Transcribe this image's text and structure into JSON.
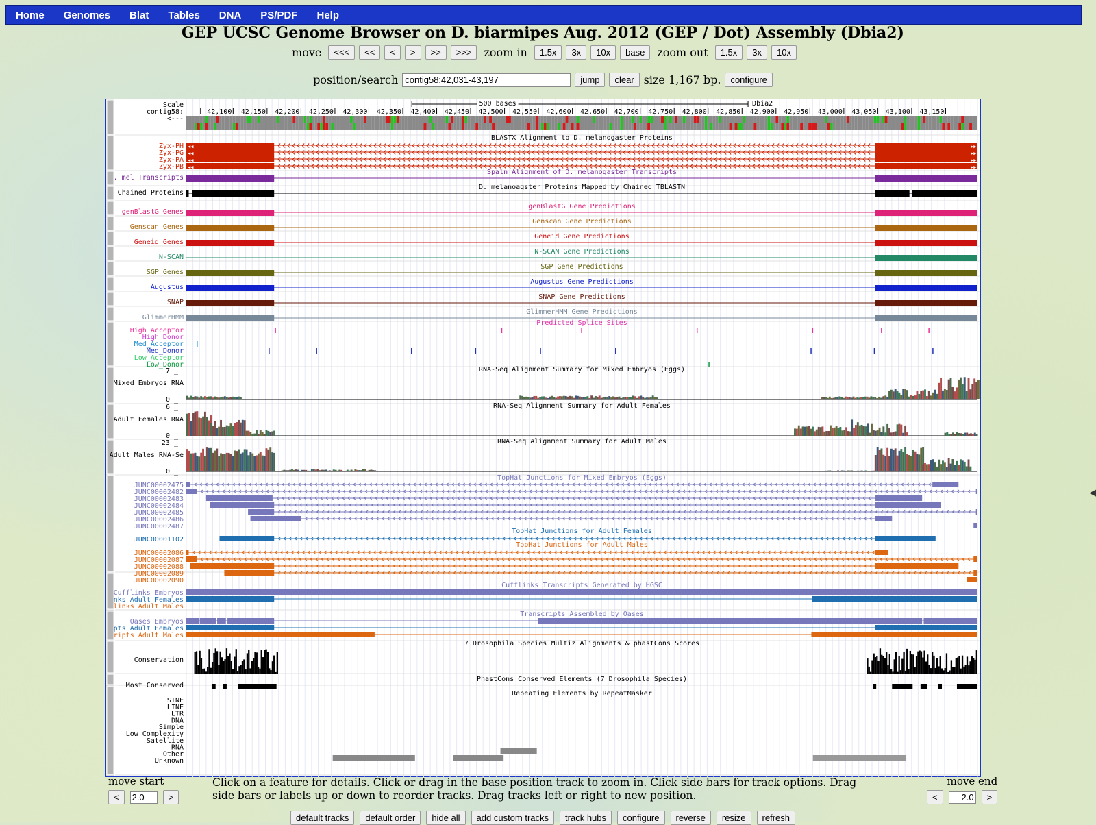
{
  "menu": [
    "Home",
    "Genomes",
    "Blat",
    "Tables",
    "DNA",
    "PS/PDF",
    "Help"
  ],
  "page_title": "GEP UCSC Genome Browser on D. biarmipes Aug. 2012 (GEP / Dot) Assembly (Dbia2)",
  "nav": {
    "move_label": "move",
    "move_buttons": [
      "<<<",
      "<<",
      "<",
      ">",
      ">>",
      ">>>"
    ],
    "zoom_in_label": "zoom in",
    "zoom_in_buttons": [
      "1.5x",
      "3x",
      "10x",
      "base"
    ],
    "zoom_out_label": "zoom out",
    "zoom_out_buttons": [
      "1.5x",
      "3x",
      "10x"
    ]
  },
  "position": {
    "label": "position/search",
    "value": "contig58:42,031-43,197",
    "jump": "jump",
    "clear": "clear",
    "size_text": "size 1,167 bp.",
    "configure": "configure"
  },
  "ruler": {
    "scale_label": "Scale",
    "chrom_label": "contig58:",
    "strand_label": "<---",
    "scale_text": "500 bases",
    "assembly": "Dbia2",
    "start": 42031,
    "end": 43197,
    "ticks": [
      "42,100",
      "42,150",
      "42,200",
      "42,250",
      "42,300",
      "42,350",
      "42,400",
      "42,450",
      "42,500",
      "42,550",
      "42,600",
      "42,650",
      "42,700",
      "42,750",
      "42,800",
      "42,850",
      "42,900",
      "42,950",
      "43,000",
      "43,050",
      "43,100",
      "43,150"
    ]
  },
  "colors": {
    "menubar": "#1a37c7",
    "blastx": "#cc2200",
    "spaln": "#7a2a9a",
    "chained": "#000000",
    "genblast": "#dd2277",
    "genscan": "#aa6611",
    "geneid": "#cc1111",
    "nscan": "#228866",
    "sgp": "#666611",
    "augustus": "#1122cc",
    "snap": "#661a0a",
    "glimmer": "#778899",
    "tophat_embryo": "#7777bb",
    "tophat_female": "#1f6fb0",
    "tophat_male": "#dd6611",
    "conservation": "#000000"
  },
  "tracks": {
    "blastx_title": "BLASTX Alignment to D. melanogaster Proteins",
    "blastx_items": [
      "Zyx-PH",
      "Zyx-PG",
      "Zyx-PA",
      "Zyx-PB"
    ],
    "spaln_label": ". mel Transcripts",
    "spaln_title": "Spaln Alignment of D. melanogaster Transcripts",
    "chained_label": "Chained Proteins",
    "chained_title": "D. melanoagster Proteins Mapped by Chained TBLASTN",
    "genblast_label": "genBlastG Genes",
    "genblast_title": "genBlastG Gene Predictions",
    "genscan_label": "Genscan Genes",
    "genscan_title": "Genscan Gene Predictions",
    "geneid_label": "Geneid Genes",
    "geneid_title": "Geneid Gene Predictions",
    "nscan_label": "N-SCAN",
    "nscan_title": "N-SCAN Gene Predictions",
    "sgp_label": "SGP Genes",
    "sgp_title": "SGP Gene Predictions",
    "augustus_label": "Augustus",
    "augustus_title": "Augustus Gene Predictions",
    "snap_label": "SNAP",
    "snap_title": "SNAP Gene Predictions",
    "glimmer_label": "GlimmerHMM",
    "glimmer_title": "GlimmerHMM Gene Predictions",
    "splice_title": "Predicted Splice Sites",
    "splice_labels": [
      "High_Acceptor",
      "High_Donor",
      "Med_Acceptor",
      "Med_Donor",
      "Low_Acceptor",
      "Low_Donor"
    ],
    "rna_embryo_title": "RNA-Seq Alignment Summary for Mixed Embryos (Eggs)",
    "rna_embryo_label": "Mixed Embryos RNA",
    "rna_embryo_max": "7 _",
    "rna_embryo_min": "0 _",
    "rna_female_title": "RNA-Seq Alignment Summary for Adult Females",
    "rna_female_label": "Adult Females RNA",
    "rna_female_max": "6 _",
    "rna_female_min": "0 _",
    "rna_male_title": "RNA-Seq Alignment Summary for Adult Males",
    "rna_male_label": "Adult Males RNA-Se",
    "rna_male_max": "23 _",
    "rna_male_min": "0 _",
    "tophat_embryo_title": "TopHat Junctions for Mixed Embryos (Eggs)",
    "tophat_embryo_items": [
      "JUNC00002475",
      "JUNC00002482",
      "JUNC00002483",
      "JUNC00002484",
      "JUNC00002485",
      "JUNC00002486",
      "JUNC00002487"
    ],
    "tophat_female_title": "TopHat Junctions for Adult Females",
    "tophat_female_items": [
      "JUNC00001102"
    ],
    "tophat_male_title": "TopHat Junctions for Adult Males",
    "tophat_male_items": [
      "JUNC00002086",
      "JUNC00002087",
      "JUNC00002088",
      "JUNC00002089",
      "JUNC00002090"
    ],
    "cufflinks_title": "Cufflinks Transcripts Generated by HGSC",
    "cufflinks_labels": [
      "Cufflinks Embryos",
      "nks Adult Females",
      "links Adult Males"
    ],
    "oases_title": "Transcripts Assembled by Oases",
    "oases_labels": [
      "Oases Embryos",
      "pts Adult Females",
      "ripts Adult Males"
    ],
    "multiz_title": "7 Drosophila Species Multiz Alignments & phastCons Scores",
    "conservation_label": "Conservation",
    "phastcons_title": "PhastCons Conserved Elements (7 Drosophila Species)",
    "most_conserved_label": "Most Conserved",
    "repeat_title": "Repeating Elements by RepeatMasker",
    "repeat_labels": [
      "SINE",
      "LINE",
      "LTR",
      "DNA",
      "Simple",
      "Low Complexity",
      "Satellite",
      "RNA",
      "Other",
      "Unknown"
    ]
  },
  "bottom": {
    "move_start": "move start",
    "move_end": "move end",
    "step_value": "2.0",
    "left_arrow": "<",
    "right_arrow": ">",
    "help_text": "Click on a feature for details. Click or drag in the base position track to zoom in. Click side bars for track options. Drag side bars or labels up or down to reorder tracks. Drag tracks left or right to new position.",
    "buttons": [
      "default tracks",
      "default order",
      "hide all",
      "add custom tracks",
      "track hubs",
      "configure",
      "reverse",
      "resize",
      "refresh"
    ]
  },
  "scrollbar_glyph": "◀"
}
